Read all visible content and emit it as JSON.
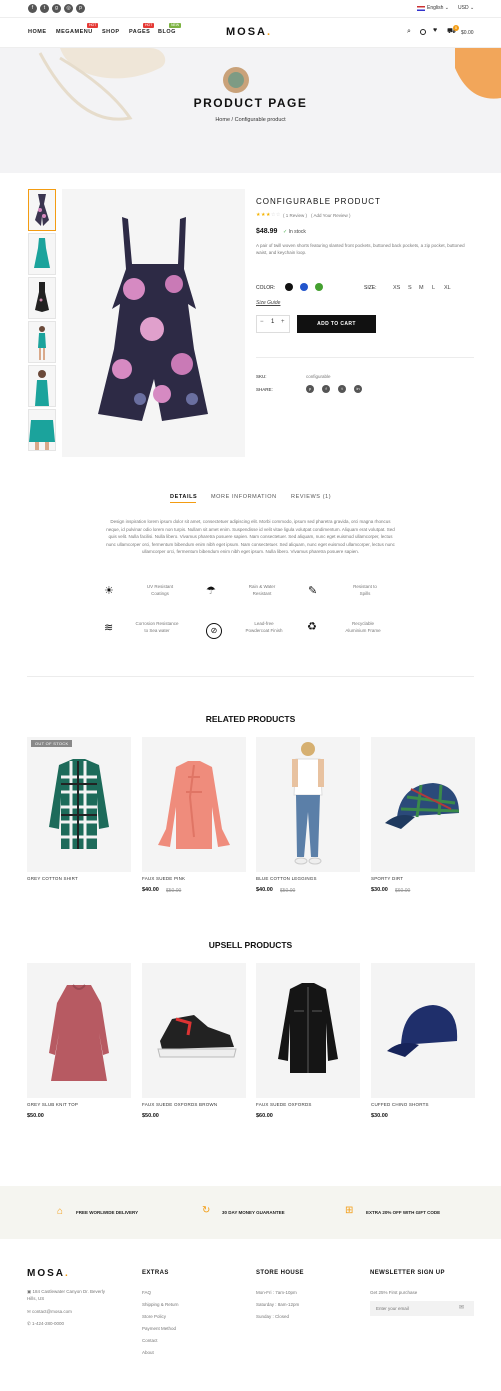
{
  "topbar": {
    "language": "English",
    "currency": "USD",
    "social": [
      "facebook-icon",
      "twitter-icon",
      "google-plus-icon",
      "instagram-icon",
      "pinterest-icon"
    ]
  },
  "nav": {
    "items": [
      "HOME",
      "MEGAMENU",
      "SHOP",
      "PAGES",
      "BLOG"
    ],
    "badges": {
      "megamenu": "HOT",
      "pages": "HOT",
      "blog": "NEW"
    },
    "logo": "MOSA",
    "logo_dot": ".",
    "cart_total": "$0.00",
    "cart_count": "0"
  },
  "hero": {
    "title": "PRODUCT PAGE",
    "crumb_home": "Home",
    "crumb_sep": "/",
    "crumb_current": "Configurable product"
  },
  "product": {
    "title": "CONFIGURABLE PRODUCT",
    "rating": 3,
    "rating_max": 5,
    "review_link": "( 1 Review )",
    "add_review": "( Add Your Review )",
    "price": "$48.99",
    "stock": "In stock",
    "description": "A pair of twill woven shorts featuring slanted front pockets, buttoned back pockets, a zip pocket, buttoned waist, and keychain loop.",
    "color_label": "COLOR:",
    "size_label": "SIZE:",
    "colors": [
      "#111111",
      "#2255cc",
      "#44a030"
    ],
    "sizes": [
      "XS",
      "S",
      "M",
      "L",
      "XL"
    ],
    "size_guide": "Size Guide",
    "qty": "1",
    "minus": "−",
    "plus": "+",
    "add_to_cart": "ADD TO CART",
    "sku_label": "SKU:",
    "sku": "configurable",
    "share_label": "SHARE:"
  },
  "tabs": {
    "items": [
      "DETAILS",
      "MORE INFORMATION",
      "REVIEWS (1)"
    ],
    "active": 0,
    "body": "Design inspiration lorem ipsum dolor sit amet, consectetuer adipiscing elit. Morbi commodo, ipsum sed pharetra gravida, orci magna rhoncus neque, id pulvinar odio lorem non turpis. Nullam sit amet enim. Suspendisse id velit vitae ligula volutpat condimentum. Aliquam erat volutpat. Sed quis velit. Nulla facilisi. Nulla libero. Vivamus pharetra posuere sapien. Nam consectetuer. Sed aliquam, nunc eget euismod ullamcorper, lectus nunc ullamcorper orci, fermentum bibendum enim nibh eget ipsum. Nam consectetuer. Sed aliquam, nunc eget euismod ullamcorper, lectus nunc ullamcorper orci, fermentum bibendum enim nibh eget ipsum. Nulla libero. Vivamus pharetra posuere sapien."
  },
  "features": [
    {
      "line1": "UV Resistant",
      "line2": "Coatings",
      "icon": "☀"
    },
    {
      "line1": "Rain & Water",
      "line2": "Resistant",
      "icon": "☂"
    },
    {
      "line1": "Resistant to",
      "line2": "Spills",
      "icon": "✎"
    },
    {
      "line1": "Corrosion Resistance",
      "line2": "to Sea water",
      "icon": "≋"
    },
    {
      "line1": "Lead-free",
      "line2": "Powdercoat Finish",
      "icon": "⊘"
    },
    {
      "line1": "Recyclable",
      "line2": "Aluminium Frame",
      "icon": "♻"
    }
  ],
  "related": {
    "title": "RELATED PRODUCTS",
    "items": [
      {
        "name": "GREY COTTON SHIRT",
        "price": "",
        "old": "",
        "tag": "OUT OF STOCK"
      },
      {
        "name": "FAUX SUEDE PINK",
        "price": "$40.00",
        "old": "$50.00",
        "tag": ""
      },
      {
        "name": "BLUE COTTON LEGGINGS",
        "price": "$40.00",
        "old": "$50.00",
        "tag": ""
      },
      {
        "name": "SPORTY DIRT",
        "price": "$30.00",
        "old": "$60.00",
        "tag": ""
      }
    ]
  },
  "upsell": {
    "title": "UPSELL PRODUCTS",
    "items": [
      {
        "name": "GREY SLUB KNIT TOP",
        "price": "$50.00"
      },
      {
        "name": "FAUX SUEDE OXFORDS BROWN",
        "price": "$50.00"
      },
      {
        "name": "FAUX SUEDE OXFORDS",
        "price": "$60.00"
      },
      {
        "name": "CUFFED CHINO SHORTS",
        "price": "$30.00"
      }
    ]
  },
  "services": [
    "FREE WORLWIDE DELIVERY",
    "30 DAY MONEY GUARANTEE",
    "EXTRA 20% OFF WITH GIFT CODE"
  ],
  "footer": {
    "logo": "MOSA",
    "address": "184 Castlewater Canyon Dr. Beverly Hills, US",
    "email": "contact@mosa.com",
    "phone": "1-424-280-0000",
    "extras_title": "EXTRAS",
    "extras": [
      "FAQ",
      "Shipping & Return",
      "Store Policy",
      "Payment Method",
      "Contact",
      "About"
    ],
    "store_title": "STORE HOUSE",
    "hours": [
      "Mon-Fri : 7am-10pm",
      "Saturday : 8am-12pm",
      "Sunday : Closed"
    ],
    "news_title": "NEWSLETTER SIGN UP",
    "news_text": "Get 25% First purchase",
    "email_placeholder": "Enter your email"
  }
}
